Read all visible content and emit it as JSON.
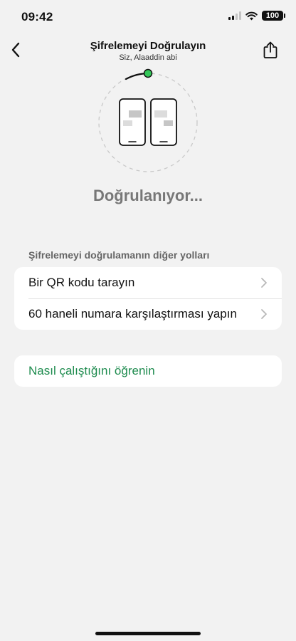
{
  "status_bar": {
    "time": "09:42",
    "battery": "100",
    "icons": [
      "signal-icon",
      "wifi-icon",
      "battery-icon"
    ]
  },
  "nav": {
    "title": "Şifrelemeyi Doğrulayın",
    "subtitle": "Siz, Alaaddin abi",
    "back_icon": "chevron-left-icon",
    "share_icon": "share-icon"
  },
  "illustration": {
    "icon": "two-phones-icon",
    "accent_color": "#34c759"
  },
  "status_text": "Doğrulanıyor...",
  "other_ways": {
    "header": "Şifrelemeyi doğrulamanın diğer yolları",
    "items": [
      {
        "label": "Bir QR kodu tarayın",
        "icon": "chevron-right-icon"
      },
      {
        "label": "60 haneli numara karşılaştırması yapın",
        "icon": "chevron-right-icon"
      }
    ]
  },
  "learn_more": {
    "label": "Nasıl çalıştığını öğrenin",
    "color": "#1f8c4f"
  }
}
